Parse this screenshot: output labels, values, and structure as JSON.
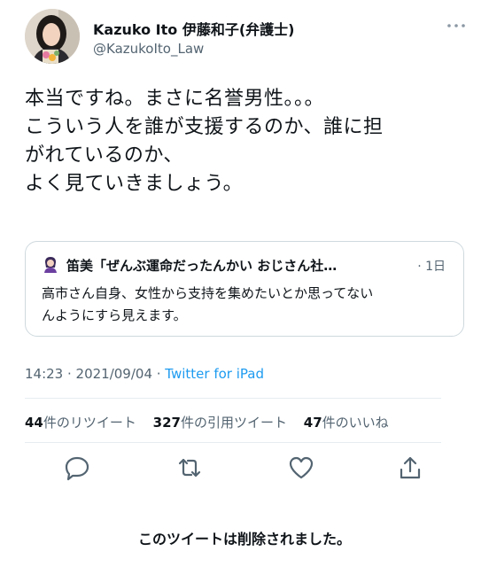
{
  "author": {
    "name": "Kazuko Ito 伊藤和子(弁護士)",
    "handle": "@KazukoIto_Law"
  },
  "tweet": {
    "lines": [
      "本当ですね。まさに名誉男性。。。",
      "こういう人を誰が支援するのか、誰に担",
      "がれているのか、",
      "よく見ていきましょう。"
    ]
  },
  "quoted_tweet": {
    "author_truncated": "笛美「ぜんぶ運命だったんかい おじさん社…",
    "time": "· 1日",
    "lines": [
      "高市さん自身、女性から支持を集めたいとか思ってない",
      "んようにすら見えます。"
    ]
  },
  "meta": {
    "time": "14:23 · 2021/09/04 · ",
    "source": "Twitter for iPad"
  },
  "stats": {
    "retweets_count": "44",
    "retweets_label": "件のリツイート",
    "quotes_count": "327",
    "quotes_label": "件の引用ツイート",
    "likes_count": "47",
    "likes_label": "件のいいね"
  },
  "actions": [
    "reply-icon",
    "retweet-icon",
    "like-icon",
    "share-icon"
  ],
  "deleted_notice": "このツイートは削除されました。",
  "colors": {
    "link": "#1d9bf0",
    "secondary_text": "#536471",
    "primary_text": "#0f1419",
    "border": "#cfd9de"
  }
}
